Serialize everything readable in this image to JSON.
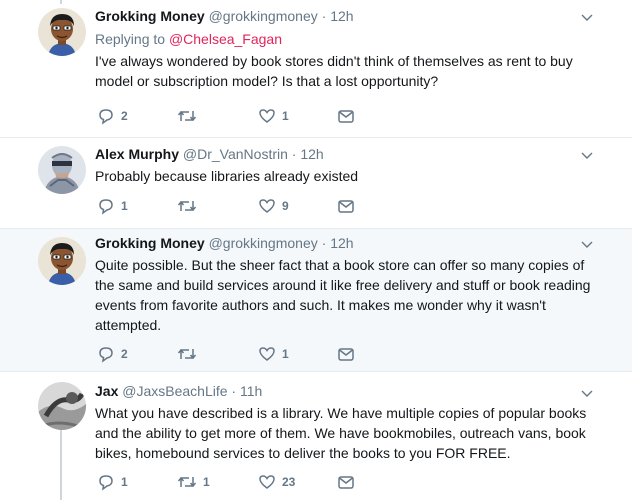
{
  "tweets": [
    {
      "name": "Grokking Money",
      "handle": "@grokkingmoney",
      "time": "12h",
      "replying_label": "Replying to",
      "replying_to": "@Chelsea_Fagan",
      "lines": [
        "I've always wondered by book stores didn't think of themselves as rent to buy",
        "model or subscription model? Is that a lost opportunity?"
      ],
      "replies": "2",
      "retweets": "",
      "likes": "1",
      "avatar": "cartoon-man-avatar"
    },
    {
      "name": "Alex Murphy",
      "handle": "@Dr_VanNostrin",
      "time": "12h",
      "lines": [
        "Probably because libraries already existed"
      ],
      "replies": "1",
      "retweets": "",
      "likes": "9",
      "avatar": "robocop-avatar"
    },
    {
      "name": "Grokking Money",
      "handle": "@grokkingmoney",
      "time": "12h",
      "lines": [
        "Quite possible. But the sheer fact that a book store can offer so many copies of",
        "the same and build services around it like free delivery and stuff or book reading",
        "events from favorite authors and such. It makes me wonder why it wasn't",
        "attempted."
      ],
      "replies": "2",
      "retweets": "",
      "likes": "1",
      "avatar": "cartoon-man-avatar"
    },
    {
      "name": "Jax",
      "handle": "@JaxsBeachLife",
      "time": "11h",
      "lines": [
        "What you have described is a library. We have multiple copies of popular books",
        "and the ability to get more of them. We have bookmobiles, outreach vans, book",
        "bikes, homebound services to deliver the books to you FOR FREE."
      ],
      "replies": "1",
      "retweets": "1",
      "likes": "23",
      "avatar": "photo-avatar"
    }
  ],
  "separator_dot": "·",
  "colors": {
    "text": "#14171a",
    "secondary": "#657786",
    "mention": "#e0245e",
    "highlight_bg": "#f5f8fa",
    "icon": "#657786"
  }
}
